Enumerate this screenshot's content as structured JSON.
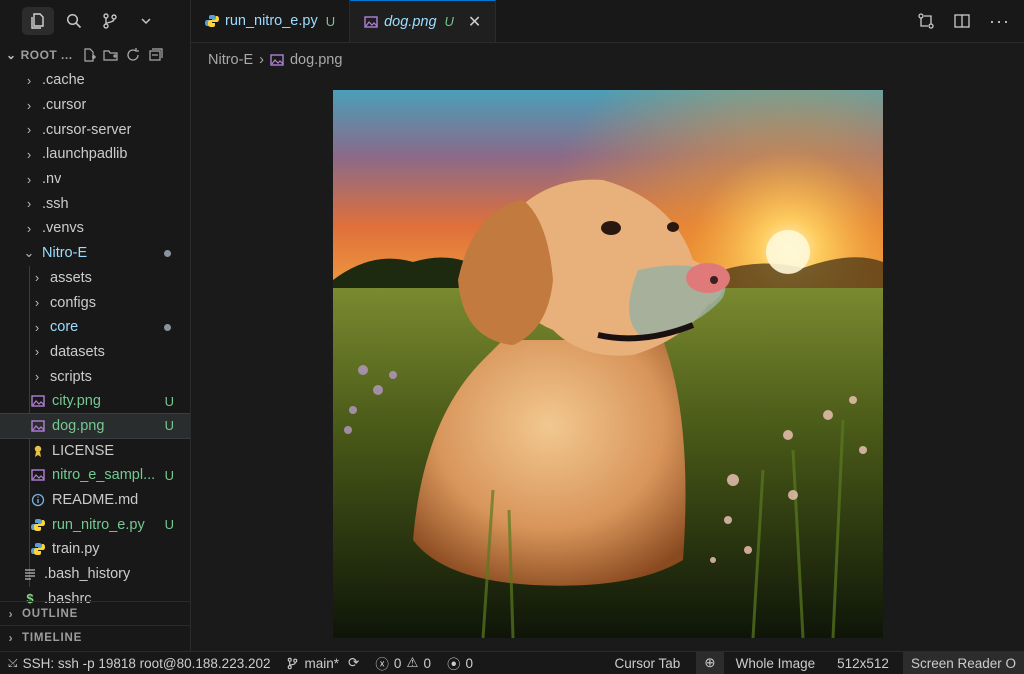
{
  "explorer": {
    "root_label": "ROOT ...",
    "items": [
      {
        "label": ".cache",
        "type": "folder",
        "depth": 0
      },
      {
        "label": ".cursor",
        "type": "folder",
        "depth": 0
      },
      {
        "label": ".cursor-server",
        "type": "folder",
        "depth": 0
      },
      {
        "label": ".launchpadlib",
        "type": "folder",
        "depth": 0
      },
      {
        "label": ".nv",
        "type": "folder",
        "depth": 0
      },
      {
        "label": ".ssh",
        "type": "folder",
        "depth": 0
      },
      {
        "label": ".venvs",
        "type": "folder",
        "depth": 0
      },
      {
        "label": "Nitro-E",
        "type": "folder-open",
        "depth": 0
      },
      {
        "label": "assets",
        "type": "folder",
        "depth": 1
      },
      {
        "label": "configs",
        "type": "folder",
        "depth": 1
      },
      {
        "label": "core",
        "type": "folder",
        "depth": 1
      },
      {
        "label": "datasets",
        "type": "folder",
        "depth": 1
      },
      {
        "label": "scripts",
        "type": "folder",
        "depth": 1
      },
      {
        "label": "city.png",
        "type": "image",
        "depth": 1,
        "badge": "U"
      },
      {
        "label": "dog.png",
        "type": "image",
        "depth": 1,
        "badge": "U"
      },
      {
        "label": "LICENSE",
        "type": "license",
        "depth": 1
      },
      {
        "label": "nitro_e_sampl...",
        "type": "image",
        "depth": 1,
        "badge": "U"
      },
      {
        "label": "README.md",
        "type": "info",
        "depth": 1
      },
      {
        "label": "run_nitro_e.py",
        "type": "python",
        "depth": 1,
        "badge": "U"
      },
      {
        "label": "train.py",
        "type": "python",
        "depth": 1
      },
      {
        "label": ".bash_history",
        "type": "text",
        "depth": 0
      },
      {
        "label": ".bashrc",
        "type": "shell",
        "depth": 0
      }
    ],
    "outline_label": "OUTLINE",
    "timeline_label": "TIMELINE"
  },
  "tabs": [
    {
      "label": "run_nitro_e.py",
      "badge": "U",
      "icon": "python-icon"
    },
    {
      "label": "dog.png",
      "badge": "U",
      "icon": "image-icon"
    }
  ],
  "breadcrumb": {
    "folder": "Nitro-E",
    "file": "dog.png"
  },
  "status": {
    "remote": "SSH: ssh -p 19818 root@80.188.223.202",
    "branch": "main*",
    "errors": "0",
    "warnings": "0",
    "ports": "0",
    "cursor_tab": "Cursor Tab",
    "whole_image": "Whole Image",
    "dimensions": "512x512",
    "screen_reader": "Screen Reader O"
  },
  "colors": {
    "accent": "#0078d4",
    "untracked": "#73c991",
    "folder_highlight": "#9cdcfe"
  }
}
